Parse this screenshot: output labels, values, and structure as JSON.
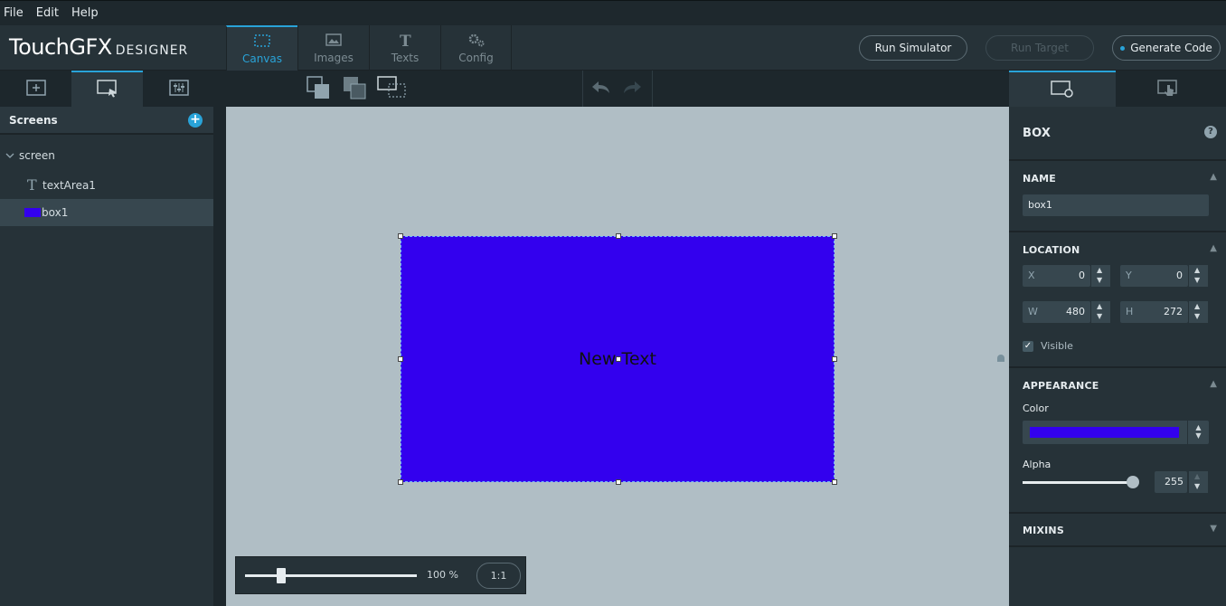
{
  "menu": [
    "File",
    "Edit",
    "Help"
  ],
  "header": {
    "logo_brand": "TouchGFX",
    "logo_suffix": "DESIGNER",
    "tabs": [
      {
        "label": "Canvas",
        "icon": "canvas-icon",
        "active": true
      },
      {
        "label": "Images",
        "icon": "images-icon",
        "active": false
      },
      {
        "label": "Texts",
        "icon": "texts-icon",
        "active": false
      },
      {
        "label": "Config",
        "icon": "config-icon",
        "active": false
      }
    ],
    "run_simulator": "Run Simulator",
    "run_target": "Run Target",
    "generate_code": "Generate Code"
  },
  "left_panel": {
    "title": "Screens",
    "tree": {
      "screen": "screen",
      "items": [
        {
          "label": "textArea1",
          "icon": "text-icon"
        },
        {
          "label": "box1",
          "icon": "box-swatch-icon"
        }
      ]
    }
  },
  "canvas": {
    "box_text": "New Text",
    "box_color": "#3300ee",
    "zoom_label": "100 %",
    "zoom_reset": "1:1",
    "zoom_level": 0.21
  },
  "right_panel": {
    "widget_type": "BOX",
    "name_section": "NAME",
    "name_value": "box1",
    "location_section": "LOCATION",
    "x_label": "X",
    "x_value": "0",
    "y_label": "Y",
    "y_value": "0",
    "w_label": "W",
    "w_value": "480",
    "h_label": "H",
    "h_value": "272",
    "visible_label": "Visible",
    "appearance_section": "APPEARANCE",
    "color_label": "Color",
    "color_value": "#3300ee",
    "alpha_label": "Alpha",
    "alpha_value": "255",
    "mixins_section": "MIXINS"
  },
  "colors": {
    "accent": "#29a3d8",
    "canvas_bg": "#b0bec5",
    "panel_bg": "#263238"
  }
}
